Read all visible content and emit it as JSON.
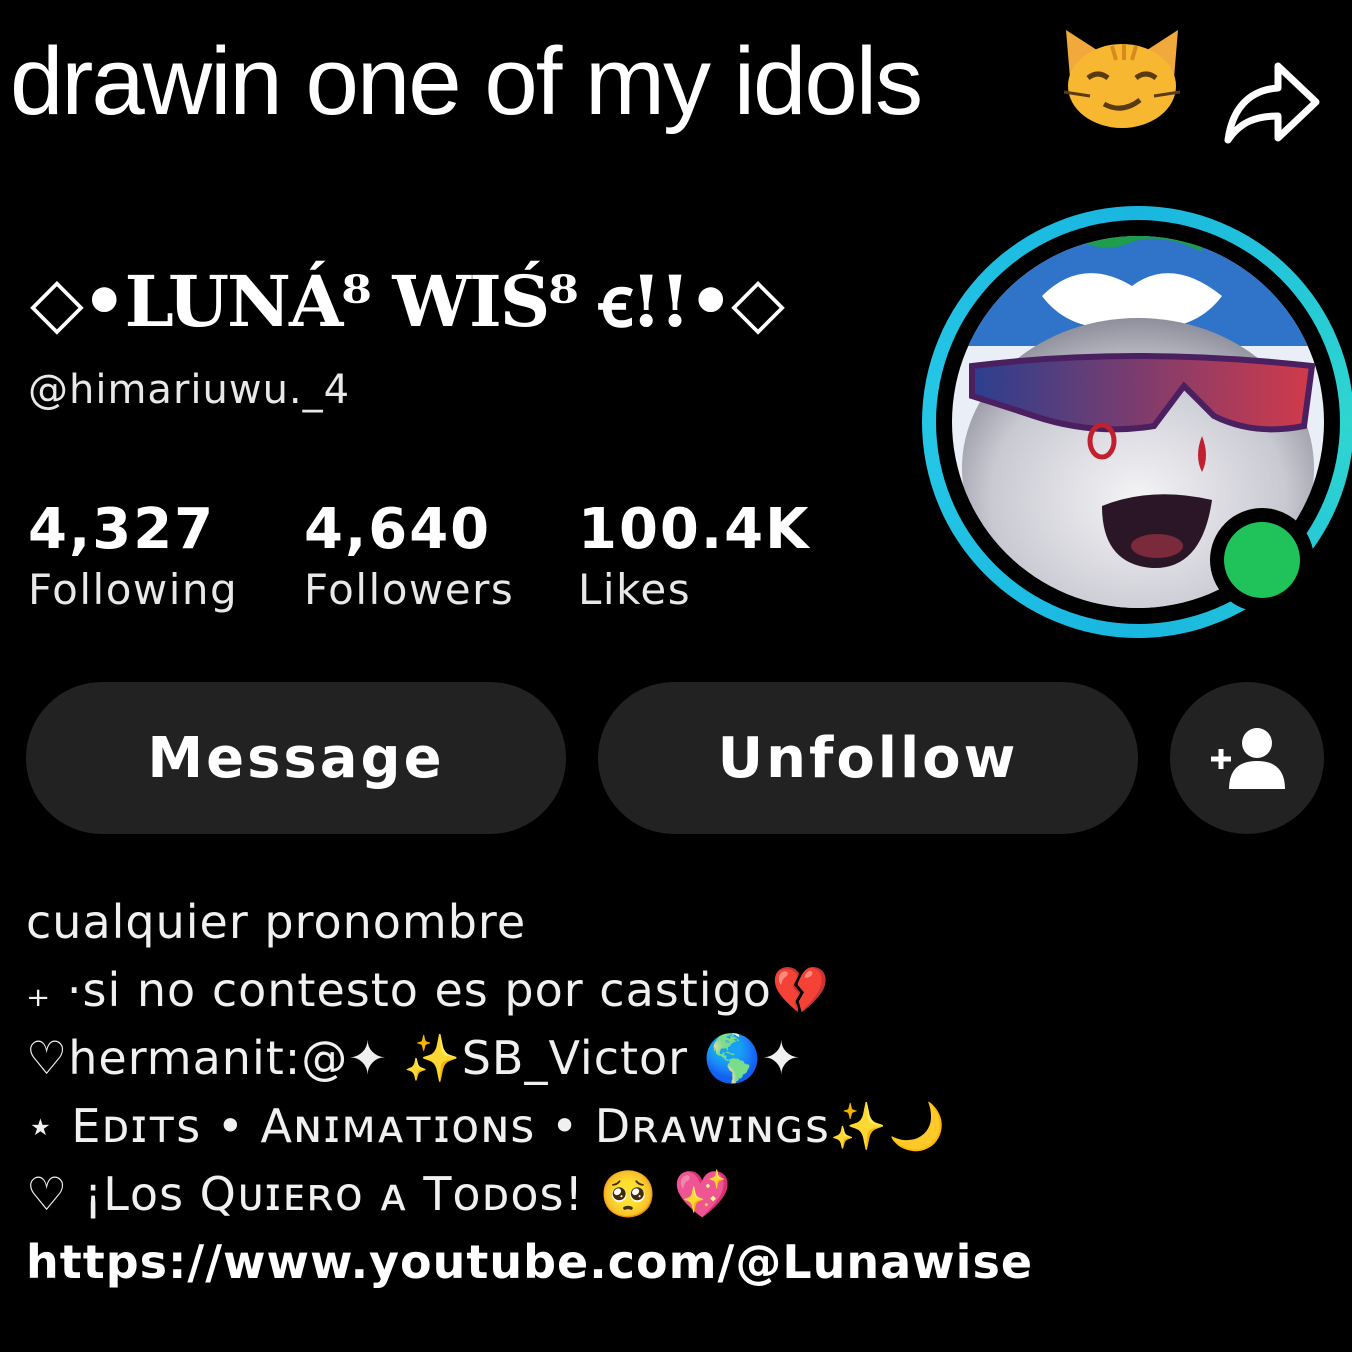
{
  "overlay": {
    "caption": "drawin one of my idols",
    "emoji": "smirking-cat-emoji"
  },
  "header": {
    "share_icon": "share-arrow-icon"
  },
  "profile": {
    "display_name": "◇•LUNÁ⁸ WIŚ⁸ ꞓ!!•◇",
    "username": "@himariuwu._4",
    "online": true,
    "ring_color": "#19b6e0",
    "online_color": "#20c25a"
  },
  "stats": [
    {
      "value": "4,327",
      "label": "Following"
    },
    {
      "value": "4,640",
      "label": "Followers"
    },
    {
      "value": "100.4K",
      "label": "Likes"
    }
  ],
  "actions": {
    "message_label": "Message",
    "unfollow_label": "Unfollow",
    "add_friend_icon": "add-user-icon"
  },
  "bio": {
    "lines": [
      "cualquier pronombre",
      "₊ ·si no contesto es por castigo💔",
      " ♡hermanit:@✦ ✨SB_Victor 🌎✦",
      "⋆ Eᴅɪᴛs • Aɴɪᴍᴀᴛɪᴏɴs • Dʀᴀᴡɪɴɢs✨🌙",
      " ♡ ¡Lᴏs Qᴜɪᴇʀᴏ ᴀ Tᴏᴅᴏs! 🥺 💖"
    ],
    "link": "https://www.youtube.com/@Lunawise"
  },
  "colors": {
    "background": "#000000",
    "button_bg": "#222222",
    "text": "#ffffff"
  }
}
